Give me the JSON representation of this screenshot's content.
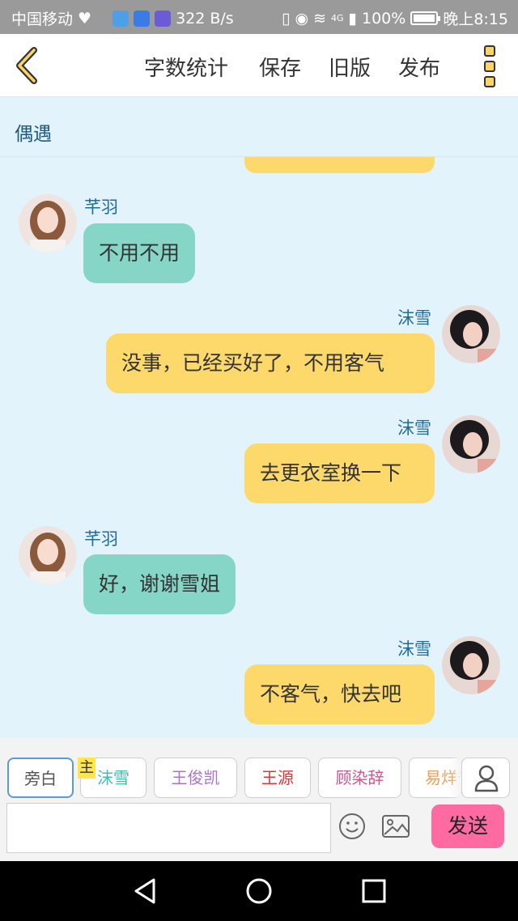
{
  "status_bar": {
    "carrier": "中国移动",
    "speed": "322 B/s",
    "network": "4G",
    "battery": "100%",
    "time": "晚上8:15"
  },
  "toolbar": {
    "back_icon": "chevron-left-icon",
    "word_count_label": "字数统计",
    "save_label": "保存",
    "old_version_label": "旧版",
    "publish_label": "发布",
    "more_icon": "more-vertical-icon"
  },
  "story": {
    "title": "偶遇"
  },
  "messages": [
    {
      "sender": "芊羽",
      "text": "不用不用",
      "side": "left",
      "color": "#86d6c8"
    },
    {
      "sender": "沫雪",
      "text": "没事，已经买好了，不用客气",
      "side": "right",
      "color": "#fcd96a"
    },
    {
      "sender": "沫雪",
      "text": "去更衣室换一下",
      "side": "right",
      "color": "#fcd96a"
    },
    {
      "sender": "芊羽",
      "text": "好，谢谢雪姐",
      "side": "left",
      "color": "#86d6c8"
    },
    {
      "sender": "沫雪",
      "text": "不客气，快去吧",
      "side": "right",
      "color": "#fcd96a"
    }
  ],
  "roles": {
    "main_tag": "主",
    "items": [
      {
        "label": "旁白",
        "color": "#555555"
      },
      {
        "label": "沫雪",
        "color": "#3fbfb0"
      },
      {
        "label": "王俊凯",
        "color": "#a974c9"
      },
      {
        "label": "王源",
        "color": "#d63a3a"
      },
      {
        "label": "顾染辞",
        "color": "#d0548f"
      },
      {
        "label": "易烊千玺",
        "color": "#e8a060"
      }
    ]
  },
  "composer": {
    "input_value": "",
    "input_placeholder": "",
    "send_label": "发送"
  },
  "colors": {
    "accent_pink": "#ff6aa3",
    "bubble_green": "#86d6c8",
    "bubble_yellow": "#fcd96a",
    "chat_bg": "#e3f3fc"
  }
}
